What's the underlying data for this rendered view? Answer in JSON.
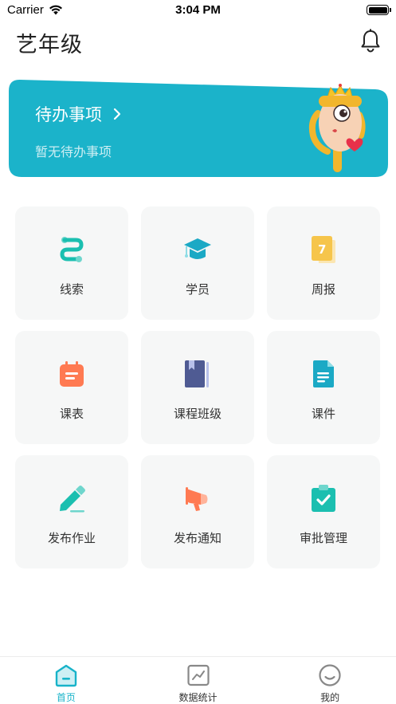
{
  "status_bar": {
    "carrier": "Carrier",
    "time": "3:04 PM"
  },
  "header": {
    "title": "艺年级",
    "bell_icon": "bell-icon"
  },
  "todo": {
    "title": "待办事项",
    "subtitle": "暂无待办事项",
    "chevron_icon": "chevron-right-icon",
    "accent": "#1bb3ca"
  },
  "grid": [
    {
      "label": "线索",
      "icon": "lead-icon"
    },
    {
      "label": "学员",
      "icon": "graduation-cap-icon"
    },
    {
      "label": "周报",
      "icon": "calendar-7-icon"
    },
    {
      "label": "课表",
      "icon": "schedule-icon"
    },
    {
      "label": "课程班级",
      "icon": "book-icon"
    },
    {
      "label": "课件",
      "icon": "document-icon"
    },
    {
      "label": "发布作业",
      "icon": "pencil-icon"
    },
    {
      "label": "发布通知",
      "icon": "megaphone-icon"
    },
    {
      "label": "审批管理",
      "icon": "clipboard-check-icon"
    }
  ],
  "tabbar": [
    {
      "label": "首页",
      "icon": "home-icon",
      "active": true
    },
    {
      "label": "数据统计",
      "icon": "chart-icon",
      "active": false
    },
    {
      "label": "我的",
      "icon": "profile-icon",
      "active": false
    }
  ],
  "colors": {
    "teal": "#18b3c9",
    "orange": "#ff7a52",
    "navy": "#4f5b93",
    "yellow": "#f6c54b",
    "tile_bg": "#f6f7f7"
  }
}
